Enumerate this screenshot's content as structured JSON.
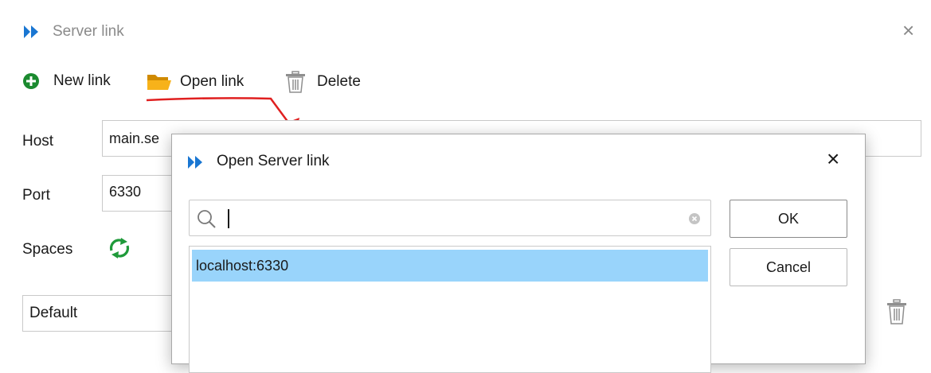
{
  "window": {
    "title": "Server link",
    "close_glyph": "×"
  },
  "toolbar": {
    "new_link": "New link",
    "open_link": "Open link",
    "delete": "Delete"
  },
  "form": {
    "host_label": "Host",
    "host_value": "main.se",
    "port_label": "Port",
    "port_value": "6330",
    "spaces_label": "Spaces",
    "space_select_value": "Default"
  },
  "dialog": {
    "title": "Open Server link",
    "close_glyph": "×",
    "search_value": "",
    "ok_label": "OK",
    "cancel_label": "Cancel",
    "items": [
      "localhost:6330"
    ],
    "selected_index": 0
  },
  "colors": {
    "brand_blue": "#1976d2",
    "add_green": "#1b8a2f",
    "folder_orange": "#f0a30a",
    "annotation_red": "#e02020",
    "selection_blue": "#99d4fb"
  },
  "icons": [
    "app-logo-icon",
    "add-circle-icon",
    "folder-open-icon",
    "trash-icon",
    "refresh-icon",
    "search-icon",
    "clear-icon",
    "close-icon"
  ]
}
